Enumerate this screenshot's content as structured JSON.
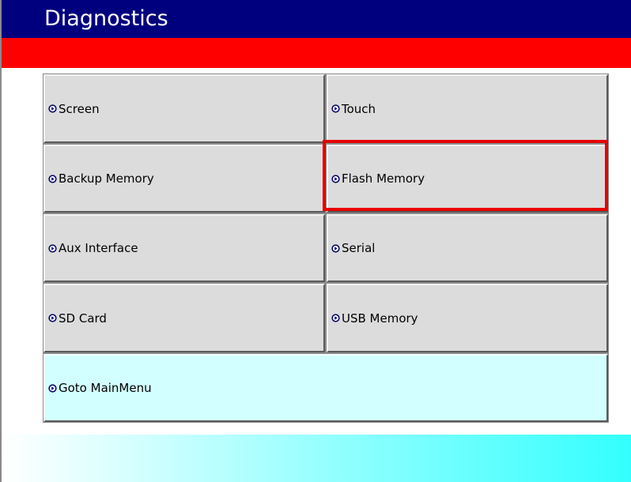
{
  "header": {
    "title": "Diagnostics"
  },
  "colors": {
    "title_bar": "#00007f",
    "red_band": "#ff0000",
    "button_face": "#dcdcdc",
    "main_menu_button_face": "#d2ffff",
    "highlight": "#e60000",
    "footer_gradient_start": "#ffffff",
    "footer_gradient_end": "#33ffff",
    "arrow_icon_fill": "#00007f"
  },
  "buttons": {
    "screen": "Screen",
    "touch": "Touch",
    "backup_memory": "Backup Memory",
    "flash_memory": "Flash Memory",
    "aux_interface": "Aux Interface",
    "serial": "Serial",
    "sd_card": "SD Card",
    "usb_memory": "USB Memory",
    "goto_main_menu": "Goto MainMenu"
  },
  "icons": {
    "button_arrow": "circle-right-arrow-icon"
  }
}
